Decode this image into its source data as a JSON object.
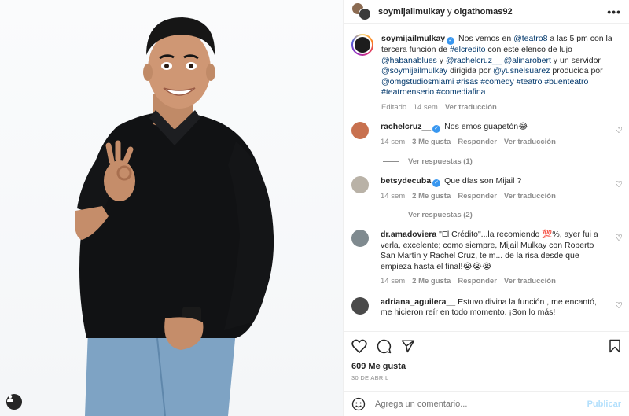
{
  "post": {
    "header": {
      "author": "soymijailmulkay",
      "connector": " y ",
      "collaborator": "olgathomas92"
    },
    "caption": {
      "author": "soymijailmulkay",
      "parts": {
        "p1": "Nos vemos en ",
        "m1": "@teatro8",
        "p2": " a las 5 pm con la tercera función de ",
        "h1": "#elcredito",
        "p3": " con este elenco de lujo ",
        "m2": "@habanablues",
        "p4": " y ",
        "m3": "@rachelcruz__",
        "p5": " ",
        "m4": "@alinarobert",
        "p6": " y un servidor ",
        "m5": "@soymijailmulkay",
        "p7": " dirigida por ",
        "m6": "@yusnelsuarez",
        "p8": " producida por ",
        "m7": "@omgstudiosmiami",
        "p9": " ",
        "h2": "#risas #comedy #teatro #buenteatro #teatroenserio #comediafina"
      },
      "edited": "Editado · 14 sem",
      "translate": "Ver traducción"
    },
    "comments": [
      {
        "user": "rachelcruz__",
        "verified": true,
        "text": "Nos emos guapetón😂",
        "time": "14 sem",
        "likes": "3 Me gusta",
        "reply": "Responder",
        "translate": "Ver traducción",
        "replies": "Ver respuestas (1)",
        "avatar_color": "#c8714f"
      },
      {
        "user": "betsydecuba",
        "verified": true,
        "text": "Que días son Mijail ?",
        "time": "14 sem",
        "likes": "2 Me gusta",
        "reply": "Responder",
        "translate": "Ver traducción",
        "replies": "Ver respuestas (2)",
        "avatar_color": "#b9b2a7"
      },
      {
        "user": "dr.amadoviera",
        "verified": false,
        "text": "\"El Crédito\"...la recomiendo 💯%, ayer fui a verla, excelente; como siempre, Mijail Mulkay con Roberto San Martín y Rachel Cruz, te m... de la risa desde que empieza hasta el final!😭😭😭",
        "time": "14 sem",
        "likes": "2 Me gusta",
        "reply": "Responder",
        "translate": "Ver traducción",
        "replies": "",
        "avatar_color": "#7f8a8f"
      },
      {
        "user": "adriana_aguilera__",
        "verified": false,
        "text": "Estuvo divina la función , me encantó, me hicieron reír en todo momento. ¡Son lo más!",
        "time": "",
        "likes": "",
        "reply": "",
        "translate": "",
        "replies": "",
        "avatar_color": "#4a4a4a"
      }
    ],
    "likes": "609 Me gusta",
    "date": "30 DE ABRIL",
    "add_comment_placeholder": "Agrega un comentario...",
    "publish": "Publicar"
  },
  "icons": [
    "more-icon",
    "heart-icon",
    "comment-icon",
    "share-icon",
    "save-icon",
    "emoji-icon",
    "user-tag-icon",
    "verified-icon"
  ],
  "colors": {
    "link": "#00376b",
    "muted": "#8e8e8e",
    "verified": "#3897f0",
    "publish_disabled": "#b2dffc"
  }
}
